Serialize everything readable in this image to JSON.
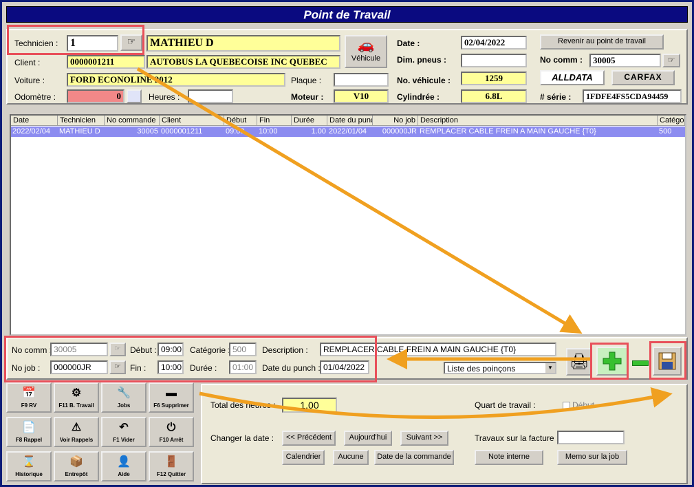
{
  "window_title": "Point de Travail",
  "header": {
    "technicien_label": "Technicien :",
    "technicien_value": "1",
    "technicien_name": "MATHIEU D",
    "client_label": "Client :",
    "client_value": "0000001211",
    "client_name": "AUTOBUS LA QUEBECOISE INC QUEBEC",
    "voiture_label": "Voiture :",
    "voiture_value": "FORD ECONOLINE 2012",
    "odometre_label": "Odomètre :",
    "odometre_value": "0",
    "heures_label": "Heures :",
    "heures_value": "",
    "vehicule_button": "Véhicule",
    "plaque_label": "Plaque :",
    "plaque_value": "",
    "moteur_label": "Moteur :",
    "moteur_value": "V10",
    "date_label": "Date :",
    "date_value": "02/04/2022",
    "dim_pneus_label": "Dim. pneus :",
    "dim_pneus_value": "",
    "no_vehicule_label": "No. véhicule :",
    "no_vehicule_value": "1259",
    "cylindree_label": "Cylindrée :",
    "cylindree_value": "6.8L",
    "revenir_button": "Revenir au point de travail",
    "no_comm_label": "No comm :",
    "no_comm_value": "30005",
    "alldata_button": "ALLDATA",
    "carfax_button": "CARFAX",
    "serie_label": "# série :",
    "serie_value": "1FDFE4FS5CDA94459"
  },
  "table": {
    "columns": [
      "Date",
      "Technicien",
      "No commande",
      "Client",
      "Début",
      "Fin",
      "Durée",
      "Date du punch",
      "No job",
      "Description",
      "Catégor"
    ],
    "rows": [
      [
        "2022/02/04",
        "MATHIEU D",
        "30005",
        "0000001211",
        "09:00",
        "10:00",
        "1.00",
        "2022/01/04",
        "000000JR",
        "REMPLACER CABLE FREIN A MAIN GAUCHE {T0}",
        "500"
      ]
    ]
  },
  "detail": {
    "no_comm_label": "No comm :",
    "no_comm_value": "30005",
    "debut_label": "Début :",
    "debut_value": "09:00",
    "categorie_label": "Catégorie :",
    "categorie_value": "500",
    "description_label": "Description :",
    "description_value": "REMPLACER CABLE FREIN A MAIN GAUCHE {T0}",
    "no_job_label": "No job :",
    "no_job_value": "000000JR",
    "fin_label": "Fin :",
    "fin_value": "10:00",
    "duree_label": "Durée :",
    "duree_value": "01:00",
    "date_punch_label": "Date du punch :",
    "date_punch_value": "01/04/2022",
    "liste_select": "Liste des poinçons"
  },
  "shortcuts": [
    {
      "label": "F9 RV",
      "icon": "calendar-icon",
      "glyph": "📅"
    },
    {
      "label": "F11 B. Travail",
      "icon": "gear-folder-icon",
      "glyph": "⚙"
    },
    {
      "label": "Jobs",
      "icon": "tools-icon",
      "glyph": "🔧"
    },
    {
      "label": "F6 Supprimer",
      "icon": "minus-icon",
      "glyph": "▬"
    },
    {
      "label": "F8 Rappel",
      "icon": "document-icon",
      "glyph": "📄"
    },
    {
      "label": "Voir Rappels",
      "icon": "recall-icon",
      "glyph": "⚠"
    },
    {
      "label": "F1 Vider",
      "icon": "undo-arrow-icon",
      "glyph": "↶"
    },
    {
      "label": "F10 Arrêt",
      "icon": "stop-icon",
      "glyph": "⏻"
    },
    {
      "label": "Historique",
      "icon": "hourglass-icon",
      "glyph": "⌛"
    },
    {
      "label": "Entrepôt",
      "icon": "warehouse-icon",
      "glyph": "📦"
    },
    {
      "label": "Aide",
      "icon": "help-person-icon",
      "glyph": "👤"
    },
    {
      "label": "F12 Quitter",
      "icon": "exit-door-icon",
      "glyph": "🚪"
    }
  ],
  "bottom": {
    "total_label": "Total des heures :",
    "total_value": "1.00",
    "quart_label": "Quart de travail :",
    "debut_check": "Début",
    "changer_date_label": "Changer la date :",
    "precedent_button": "<< Précédent",
    "aujourdhui_button": "Aujourd'hui",
    "suivant_button": "Suivant >>",
    "calendrier_button": "Calendrier",
    "aucune_button": "Aucune",
    "date_commande_button": "Date de la commande",
    "travaux_label": "Travaux sur la facture :",
    "travaux_value": "",
    "note_interne_button": "Note interne",
    "memo_button": "Memo sur la job"
  },
  "colors": {
    "title_bar": "#0a0a80",
    "annotation_box": "#e8505a",
    "annotation_arrow": "#f0a020",
    "selected_row": "#8c8cf0",
    "highlight_field": "#ffff99"
  }
}
